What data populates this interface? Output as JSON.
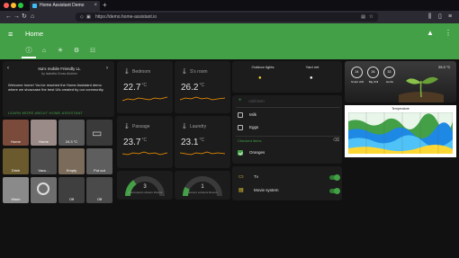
{
  "browser": {
    "tab_title": "Home Assistant Demo",
    "url": "https://demo.home-assistant.io",
    "colors": {
      "close": "#ff5f57",
      "minimize": "#febc2e",
      "maximize": "#28c840"
    }
  },
  "header": {
    "title": "Home",
    "accent": "#43a047",
    "views": [
      {
        "icon": "info-icon",
        "glyph": "ⓘ"
      },
      {
        "icon": "home-icon",
        "glyph": "⌂"
      },
      {
        "icon": "lightbulb-icon",
        "glyph": "☀"
      },
      {
        "icon": "network-icon",
        "glyph": "⚙"
      },
      {
        "icon": "sitemap-icon",
        "glyph": "☷"
      }
    ]
  },
  "welcome": {
    "title": "Isa's mobile Friendly LL",
    "subtitle": "by Isabella Gross Alström",
    "text": "Welcome home! You've reached the Home Assistant demo where we showcase the best UIs created by our community.",
    "learn_more": "LEARN MORE ABOUT HOME ASSISTANT"
  },
  "tiles": [
    {
      "label": "Home",
      "bg": "#7a4a3a"
    },
    {
      "label": "Home",
      "bg": "#9a8a88"
    },
    {
      "label": "24.3 °C",
      "bg": "#5b5b5b"
    },
    {
      "label": "",
      "bg": "#3a3a3a"
    },
    {
      "label": "Drink",
      "bg": "#6a5a2e"
    },
    {
      "label": "Vacu...",
      "bg": "#4d4d4d"
    },
    {
      "label": "Empty",
      "bg": "#7b6b5b"
    },
    {
      "label": "Put out",
      "bg": "#5e5e5e"
    },
    {
      "label": "Wash",
      "bg": "#8a8a8a"
    },
    {
      "label": "",
      "bg": "#6e6e6e"
    },
    {
      "label": "Off",
      "bg": "#3f3f3f"
    },
    {
      "label": "Off",
      "bg": "#4a4a4a"
    }
  ],
  "sensors": [
    {
      "name": "Bedroom",
      "value": "22.7",
      "unit": "°C"
    },
    {
      "name": "S's room",
      "value": "26.2",
      "unit": "°C"
    },
    {
      "name": "Passage",
      "value": "23.7",
      "unit": "°C"
    },
    {
      "name": "Laundry",
      "value": "23.1",
      "unit": "°C"
    }
  ],
  "gauges": [
    {
      "value": "3",
      "name": "Unoccupied Lobsters Rooms",
      "fraction": 0.3,
      "color": "#43a047"
    },
    {
      "value": "1",
      "name": "Homers Lobsters Rooms",
      "fraction": 0.15,
      "color": "#43a047"
    }
  ],
  "lights": [
    {
      "name": "Outdoor lights",
      "color": "#fdd835"
    },
    {
      "name": "Yard net",
      "color": "#ffffff"
    }
  ],
  "shopping": {
    "add_placeholder": "Add item",
    "items": [
      "Milk",
      "Eggs"
    ],
    "checked_title": "Checked items",
    "checked_items": [
      "Oranges"
    ]
  },
  "switches": [
    {
      "name": "Tv",
      "icon": "tv-icon",
      "glyph": "▭"
    },
    {
      "name": "Movie system",
      "icon": "speaker-icon",
      "glyph": "▤"
    }
  ],
  "weather": {
    "badges": [
      {
        "value": "24",
        "label": "Smart chill"
      },
      {
        "value": "26",
        "label": "Big chill"
      },
      {
        "value": "33",
        "label": "Herbs"
      }
    ],
    "temperature": "25.3 °C"
  },
  "camera": {
    "title": "Temperature",
    "colors": [
      "#2e7d32",
      "#1e88e5",
      "#4fc3f7",
      "#fdd835"
    ]
  }
}
